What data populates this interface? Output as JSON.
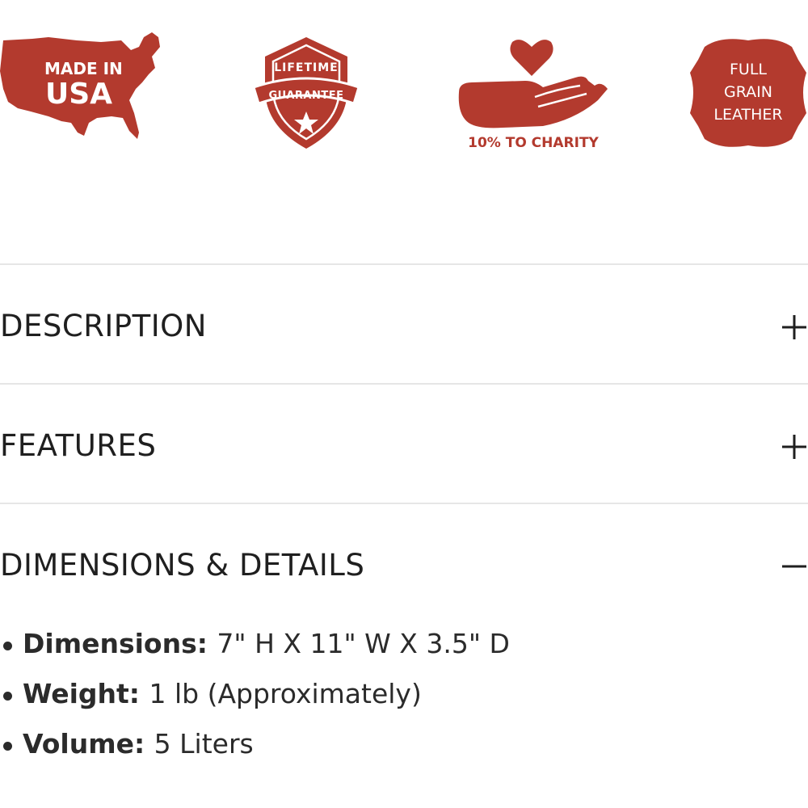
{
  "brand_color": "#b33a2e",
  "badges": {
    "usa": {
      "line1": "MADE IN",
      "line2": "USA",
      "icon": "usa-map-icon"
    },
    "guarantee": {
      "line1": "LIFETIME",
      "line2": "GUARANTEE",
      "icon": "shield-star-icon"
    },
    "charity": {
      "caption": "10% TO CHARITY",
      "icon": "hand-heart-icon"
    },
    "leather": {
      "line1": "FULL",
      "line2": "GRAIN",
      "line3": "LEATHER",
      "icon": "leather-hide-icon"
    }
  },
  "accordion": {
    "sections": [
      {
        "title": "DESCRIPTION",
        "toggle": "+",
        "expanded": false
      },
      {
        "title": "FEATURES",
        "toggle": "+",
        "expanded": false
      },
      {
        "title": "DIMENSIONS & DETAILS",
        "toggle": "−",
        "expanded": true
      }
    ],
    "details": [
      {
        "label": "Dimensions:",
        "value": "7\" H X 11\" W X 3.5\" D"
      },
      {
        "label": "Weight:",
        "value": "1 lb (Approximately)"
      },
      {
        "label": "Volume:",
        "value": "5 Liters"
      }
    ]
  }
}
